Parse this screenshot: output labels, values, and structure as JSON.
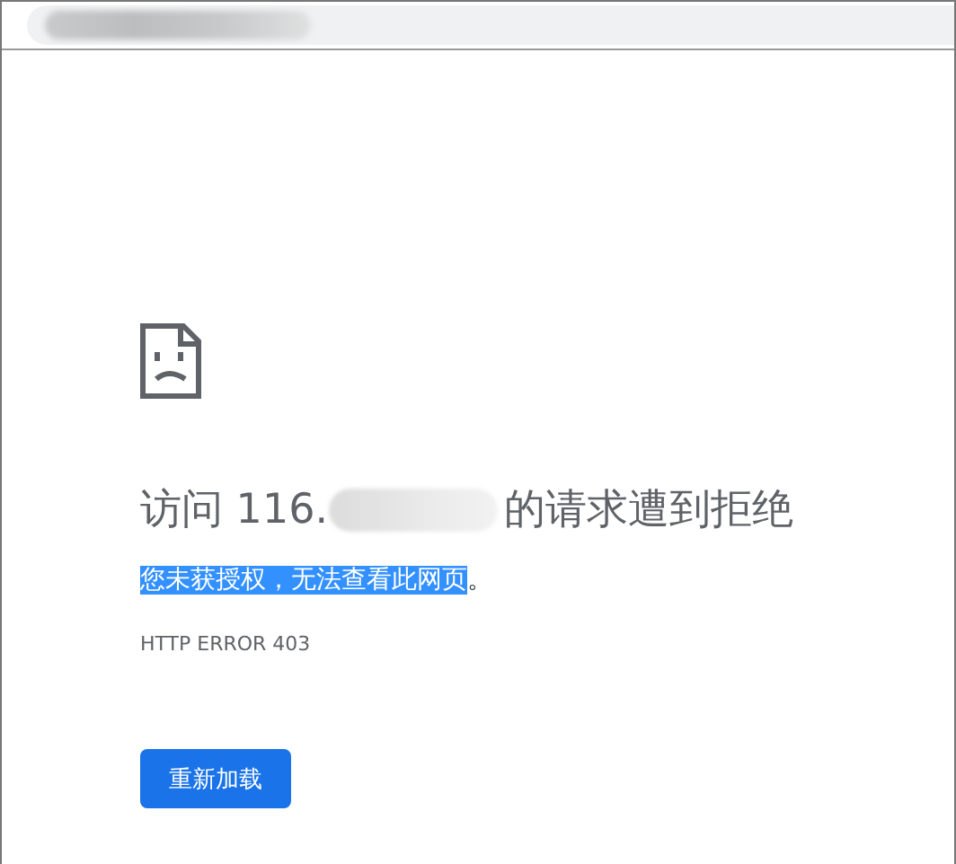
{
  "address_bar": {
    "redacted": true
  },
  "error": {
    "heading_prefix": "访问 116.",
    "heading_redacted": true,
    "heading_suffix": "的请求遭到拒绝",
    "message_parts": [
      {
        "text": "您未获授权，无法查看此网页",
        "selected": true
      },
      {
        "text": "。",
        "selected": false
      }
    ],
    "code": "HTTP ERROR 403"
  },
  "buttons": [
    {
      "label": "重新加载",
      "kind": "primary"
    }
  ]
}
